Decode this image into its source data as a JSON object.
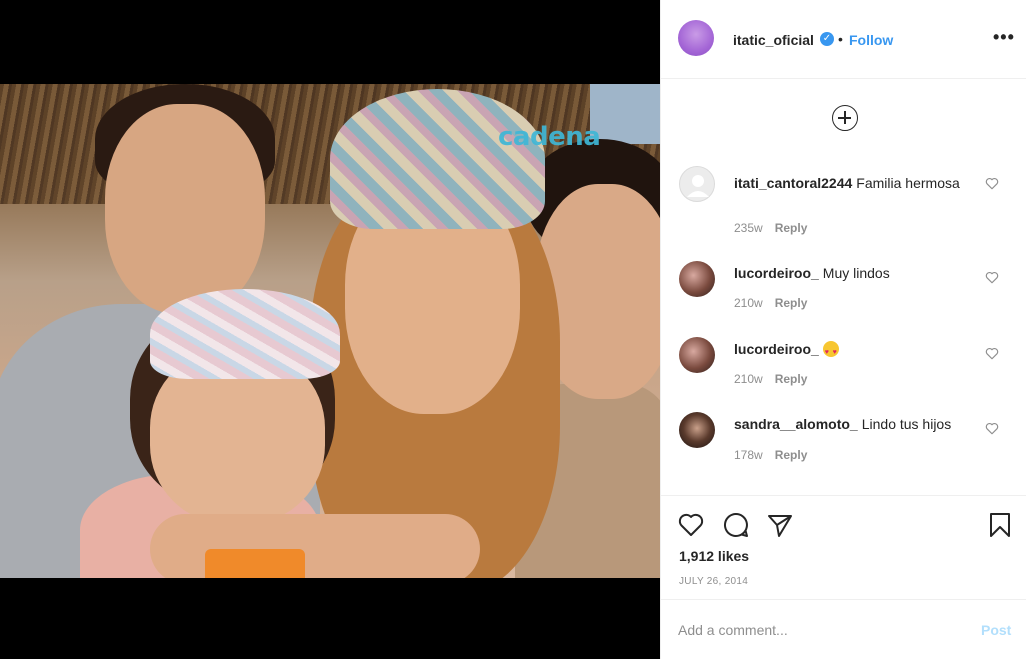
{
  "photo": {
    "watermark": "cadena"
  },
  "header": {
    "username": "itatic_oficial",
    "verified_glyph": "✓",
    "separator": "•",
    "follow_label": "Follow",
    "more_label": "•••"
  },
  "comments": [
    {
      "username": "itati_cantoral2244",
      "text": "Familia hermosa",
      "age": "235w",
      "reply": "Reply"
    },
    {
      "username": "lucordeiroo_",
      "text": "Muy lindos",
      "age": "210w",
      "reply": "Reply"
    },
    {
      "username": "lucordeiroo_",
      "text": "",
      "emoji": "heart-eyes-emoji",
      "age": "210w",
      "reply": "Reply"
    },
    {
      "username": "sandra__alomoto_",
      "text": "Lindo tus hijos",
      "age": "178w",
      "reply": "Reply"
    }
  ],
  "likes": "1,912 likes",
  "date": "JULY 26, 2014",
  "add_comment": {
    "placeholder": "Add a comment...",
    "post_label": "Post"
  },
  "colors": {
    "accent": "#3897f0",
    "post_disabled": "#b2dffc",
    "muted": "#8e8e8e",
    "text": "#262626"
  }
}
